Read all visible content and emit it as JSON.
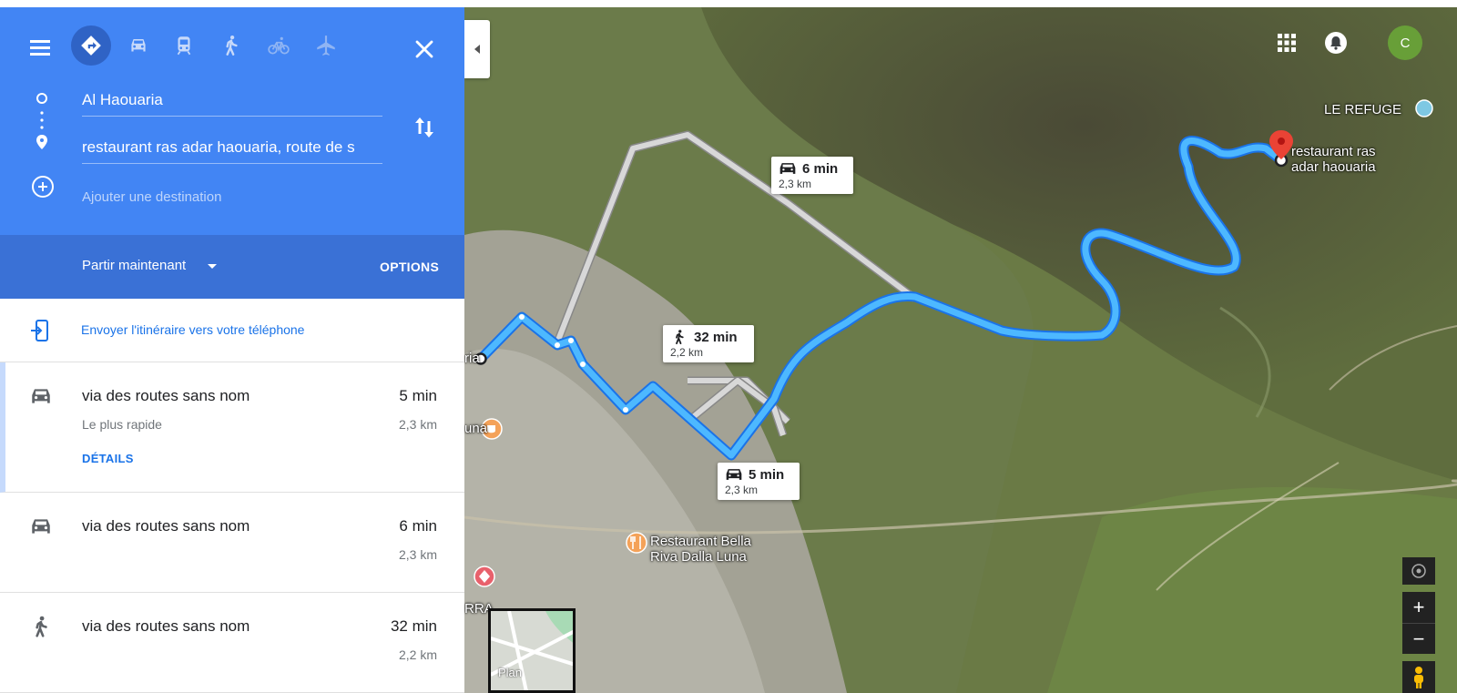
{
  "directions": {
    "origin": "Al Haouaria",
    "destination": "restaurant ras adar haouaria, route de s",
    "add_destination_placeholder": "Ajouter une destination",
    "depart_label": "Partir maintenant",
    "options_label": "OPTIONS",
    "send_to_phone": "Envoyer l'itinéraire vers votre téléphone",
    "modes": [
      "directions",
      "car",
      "transit",
      "walk",
      "bicycle",
      "flight"
    ],
    "active_mode": "directions"
  },
  "routes": [
    {
      "mode_icon": "car-icon",
      "name": "via des routes sans nom",
      "time": "5 min",
      "distance": "2,3 km",
      "subtitle": "Le plus rapide",
      "details_link": "DÉTAILS",
      "selected": true
    },
    {
      "mode_icon": "car-icon",
      "name": "via des routes sans nom",
      "time": "6 min",
      "distance": "2,3 km"
    },
    {
      "mode_icon": "walk-icon",
      "name": "via des routes sans nom",
      "time": "32 min",
      "distance": "2,2 km"
    }
  ],
  "map": {
    "callouts": [
      {
        "mode": "car",
        "time": "6 min",
        "distance": "2,3 km"
      },
      {
        "mode": "walk",
        "time": "32 min",
        "distance": "2,2 km"
      },
      {
        "mode": "car",
        "time": "5 min",
        "distance": "2,3 km"
      }
    ],
    "labels": {
      "refuge": "LE REFUGE",
      "destination": "restaurant ras adar haouaria",
      "destination_line1": "restaurant ras",
      "destination_line2": "adar haouaria",
      "origin_fragment": "ria",
      "luna_fragment": "una",
      "restaurant_bella_line1": "Restaurant Bella",
      "restaurant_bella_line2": "Riva Dalla Luna",
      "rra_fragment": "RRA"
    },
    "avatar_letter": "C",
    "plan_label": "Plan",
    "zoom_in": "+",
    "zoom_out": "−"
  },
  "colors": {
    "header_blue": "#4285f4",
    "bar_blue": "#3a71d6",
    "route_primary": "#4db8ff",
    "route_alt": "#cfcfcf",
    "link_blue": "#1a73e8"
  }
}
